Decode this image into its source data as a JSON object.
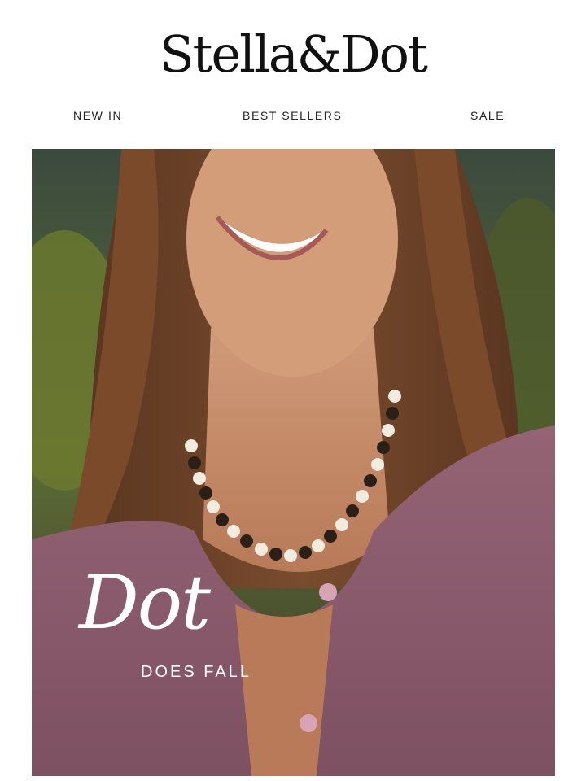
{
  "brand": {
    "logo_text": "Stella&Dot"
  },
  "nav": {
    "items": [
      {
        "label": "NEW IN"
      },
      {
        "label": "BEST SELLERS"
      },
      {
        "label": "SALE"
      }
    ]
  },
  "hero": {
    "title": "Dot",
    "subtitle": "DOES FALL",
    "image_desc": "Smiling woman in a mauve cardigan wearing a beaded necklace"
  },
  "colors": {
    "text": "#111111",
    "cardigan": "#8a5a6e",
    "skin": "#c98f6c",
    "hair": "#6b4128"
  }
}
